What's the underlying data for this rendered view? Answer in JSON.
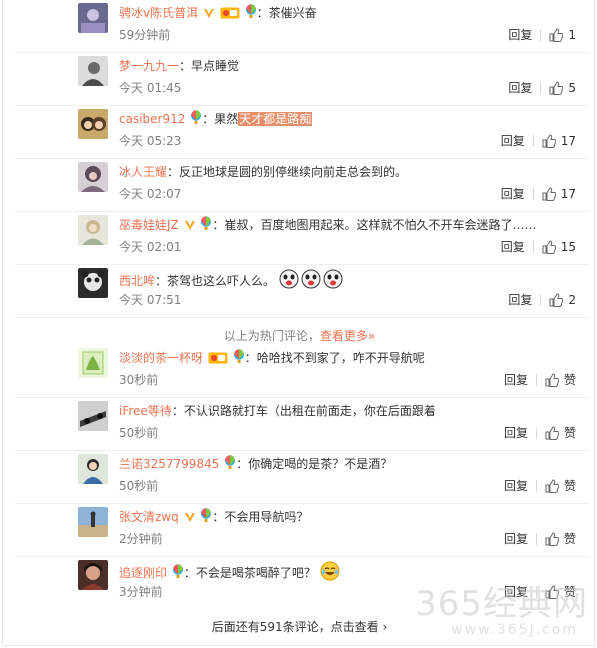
{
  "colors": {
    "username": "#eb7350",
    "highlight": "#e68f6a",
    "muted": "#808080"
  },
  "icons": [
    "verified-v-icon",
    "vip-icon",
    "balloon-badge-icon",
    "thumb-up-icon",
    "laugh-emoji-icon",
    "cry-laugh-emoji-icon"
  ],
  "comments": [
    {
      "user": "骋冰v陈氏普洱",
      "badges": "v-vip-balloon",
      "text": "茶催兴奋",
      "time": "59分钟前",
      "reply": "回复",
      "likes": "1"
    },
    {
      "user": "梦一九九一",
      "badges": "",
      "text": "早点睡觉",
      "time": "今天 01:45",
      "reply": "回复",
      "likes": "5"
    },
    {
      "user": "casiber912",
      "badges": "balloon",
      "text_prefix": "果然",
      "text_highlight": "天才都是路痴",
      "time": "今天 05:23",
      "reply": "回复",
      "likes": "17"
    },
    {
      "user": "冰人王耀",
      "badges": "",
      "text": "反正地球是圆的别停继续向前走总会到的。",
      "time": "今天 02:07",
      "reply": "回复",
      "likes": "17"
    },
    {
      "user": "巫毒娃娃JZ",
      "badges": "v-balloon",
      "text": "崔叔，百度地图用起来。这样就不怕久不开车会迷路了……",
      "time": "今天 02:01",
      "reply": "回复",
      "likes": "15"
    },
    {
      "user": "西北哞",
      "badges": "",
      "text": "茶驾也这么吓人么。",
      "time": "今天 07:51",
      "reply": "回复",
      "likes": "2"
    },
    {
      "user": "淡淡的茶一杯呀",
      "badges": "vip-balloon",
      "text": "哈哈找不到家了，咋不开导航呢",
      "time": "30秒前",
      "reply": "回复",
      "likes": "赞"
    },
    {
      "user": "iFree等待",
      "badges": "",
      "text": "不认识路就打车（出租在前面走，你在后面跟着",
      "time": "50秒前",
      "reply": "回复",
      "likes": "赞"
    },
    {
      "user": "兰诺3257799845",
      "badges": "balloon",
      "text": "你确定喝的是茶？不是酒？",
      "time": "50秒前",
      "reply": "回复",
      "likes": "赞"
    },
    {
      "user": "张文清zwq",
      "badges": "v-balloon",
      "text": "不会用导航吗？",
      "time": "2分钟前",
      "reply": "回复",
      "likes": "赞"
    },
    {
      "user": "追逐刚印",
      "badges": "balloon",
      "text": "不会是喝茶喝醉了吧？",
      "time": "3分钟前",
      "reply": "回复",
      "likes": "赞"
    }
  ],
  "hot_note": {
    "text": "以上为热门评论，",
    "more": "查看更多»"
  },
  "footer": "后面还有591条评论，点击查看 ›",
  "watermark": {
    "brand": "365经典网",
    "url": "www.365J.com"
  }
}
